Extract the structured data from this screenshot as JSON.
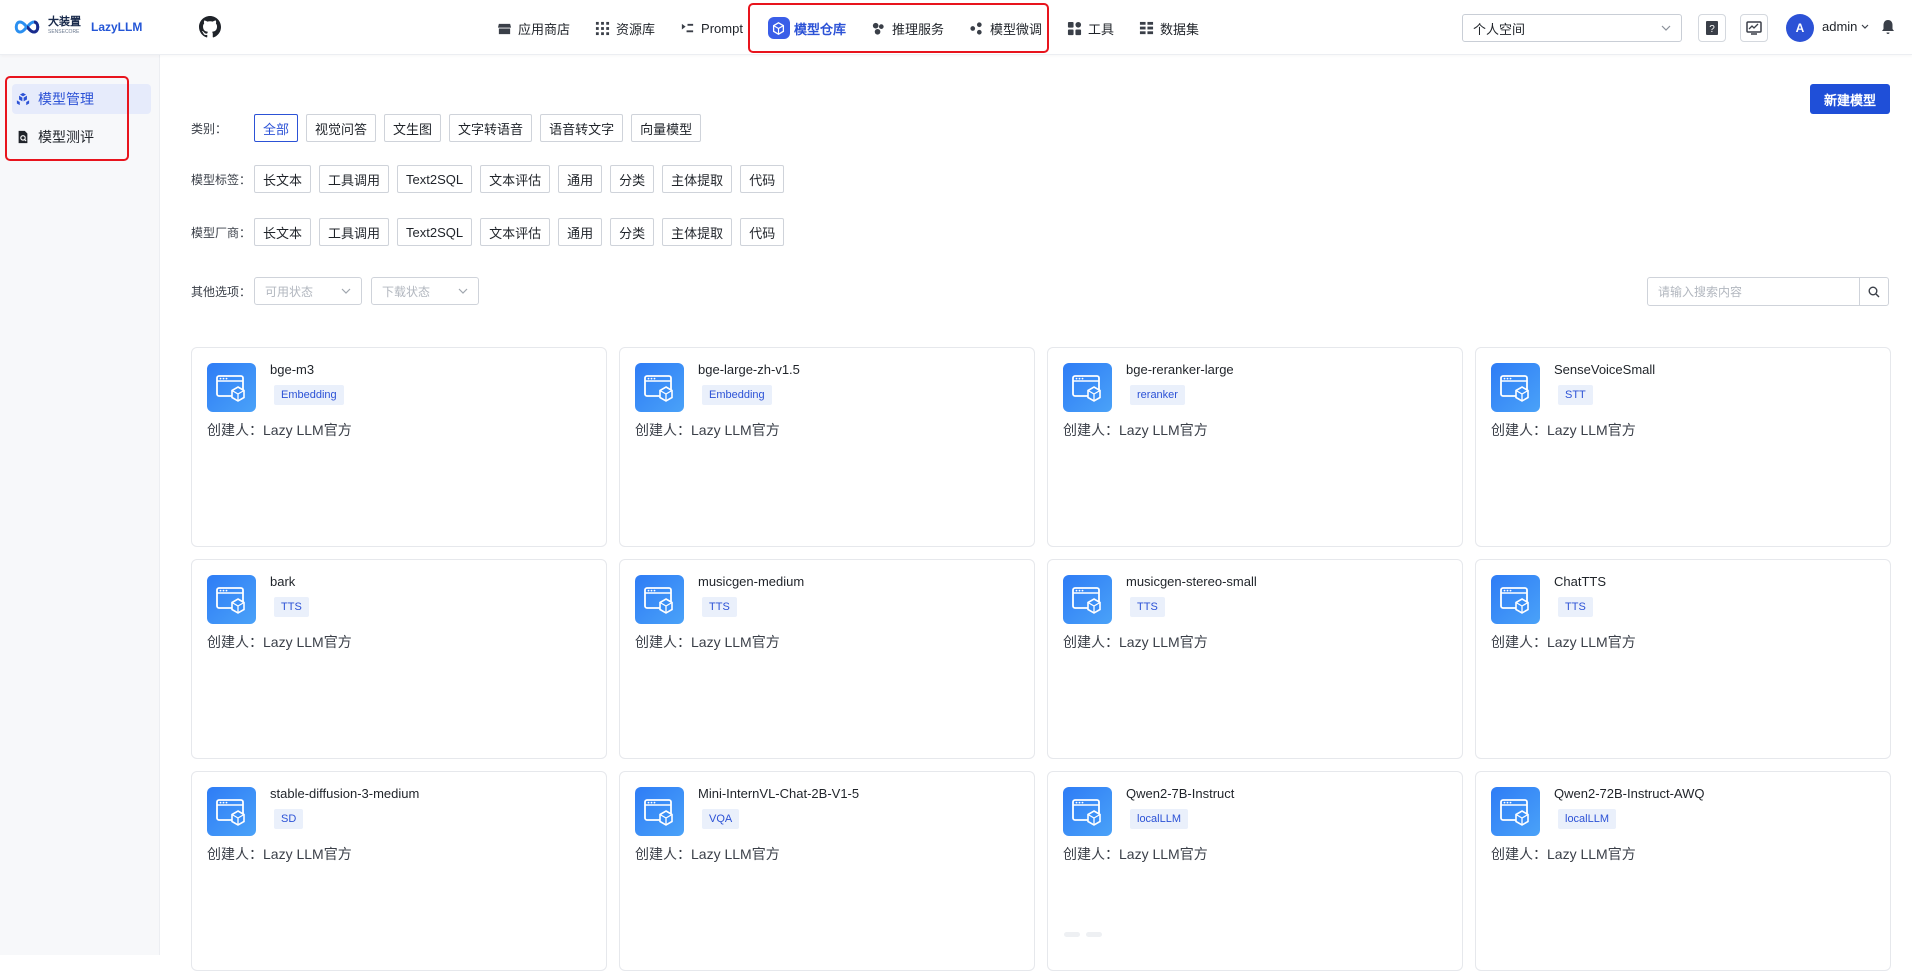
{
  "brand": {
    "name_cn": "大装置",
    "sub": "SENSECORE",
    "name_en": "LazyLLM"
  },
  "nav": [
    {
      "label": "应用商店",
      "icon": "store-icon",
      "active": false
    },
    {
      "label": "资源库",
      "icon": "grid-icon",
      "active": false
    },
    {
      "label": "Prompt",
      "icon": "prompt-icon",
      "active": false
    },
    {
      "label": "模型仓库",
      "icon": "cube-icon",
      "active": true
    },
    {
      "label": "推理服务",
      "icon": "cluster-icon",
      "active": false
    },
    {
      "label": "模型微调",
      "icon": "tune-icon",
      "active": false
    },
    {
      "label": "工具",
      "icon": "tools-icon",
      "active": false
    },
    {
      "label": "数据集",
      "icon": "dataset-icon",
      "active": false
    }
  ],
  "header": {
    "space": "个人空间",
    "user_initial": "A",
    "user_name": "admin"
  },
  "sidebar": {
    "items": [
      {
        "label": "模型管理",
        "icon": "cube-icon",
        "active": true
      },
      {
        "label": "模型测评",
        "icon": "doc-eval-icon",
        "active": false
      }
    ]
  },
  "actions": {
    "new_model": "新建模型"
  },
  "filters": {
    "category": {
      "label": "类别：",
      "options": [
        "全部",
        "视觉问答",
        "文生图",
        "文字转语音",
        "语音转文字",
        "向量模型"
      ],
      "selected": "全部"
    },
    "tags": {
      "label": "模型标签：",
      "options": [
        "长文本",
        "工具调用",
        "Text2SQL",
        "文本评估",
        "通用",
        "分类",
        "主体提取",
        "代码"
      ]
    },
    "vendor": {
      "label": "模型厂商：",
      "options": [
        "长文本",
        "工具调用",
        "Text2SQL",
        "文本评估",
        "通用",
        "分类",
        "主体提取",
        "代码"
      ]
    },
    "other": {
      "label": "其他选项：",
      "status_placeholder": "可用状态",
      "download_placeholder": "下载状态"
    }
  },
  "search": {
    "placeholder": "请输入搜索内容"
  },
  "creator_prefix": "创建人：",
  "models": [
    {
      "name": "bge-m3",
      "tag": "Embedding",
      "creator": "Lazy LLM官方"
    },
    {
      "name": "bge-large-zh-v1.5",
      "tag": "Embedding",
      "creator": "Lazy LLM官方"
    },
    {
      "name": "bge-reranker-large",
      "tag": "reranker",
      "creator": "Lazy LLM官方"
    },
    {
      "name": "SenseVoiceSmall",
      "tag": "STT",
      "creator": "Lazy LLM官方"
    },
    {
      "name": "bark",
      "tag": "TTS",
      "creator": "Lazy LLM官方"
    },
    {
      "name": "musicgen-medium",
      "tag": "TTS",
      "creator": "Lazy LLM官方"
    },
    {
      "name": "musicgen-stereo-small",
      "tag": "TTS",
      "creator": "Lazy LLM官方"
    },
    {
      "name": "ChatTTS",
      "tag": "TTS",
      "creator": "Lazy LLM官方"
    },
    {
      "name": "stable-diffusion-3-medium",
      "tag": "SD",
      "creator": "Lazy LLM官方"
    },
    {
      "name": "Mini-InternVL-Chat-2B-V1-5",
      "tag": "VQA",
      "creator": "Lazy LLM官方"
    },
    {
      "name": "Qwen2-7B-Instruct",
      "tag": "localLLM",
      "creator": "Lazy LLM官方"
    },
    {
      "name": "Qwen2-72B-Instruct-AWQ",
      "tag": "localLLM",
      "creator": "Lazy LLM官方"
    }
  ]
}
